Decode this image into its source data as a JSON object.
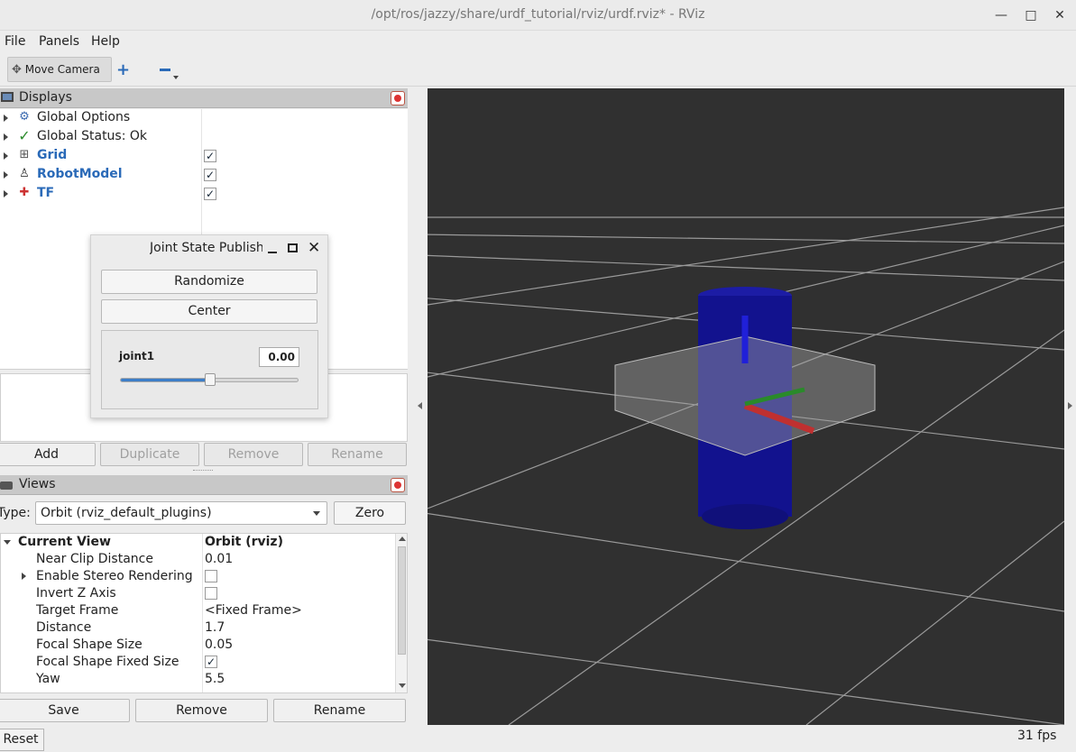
{
  "window": {
    "title": "/opt/ros/jazzy/share/urdf_tutorial/rviz/urdf.rviz* - RViz",
    "minimize_icon": "minimize-icon",
    "maximize_icon": "maximize-icon",
    "close_icon": "close-icon"
  },
  "menu": {
    "file": "File",
    "panels": "Panels",
    "help": "Help"
  },
  "toolbar": {
    "move_camera": "Move Camera"
  },
  "displays": {
    "header": "Displays",
    "items": [
      {
        "label": "Global Options",
        "icon": "gear-icon",
        "checked": null
      },
      {
        "label": "Global Status: Ok",
        "icon": "checkmark-icon",
        "checked": null
      },
      {
        "label": "Grid",
        "icon": "grid-icon",
        "checked": true
      },
      {
        "label": "RobotModel",
        "icon": "robot-icon",
        "checked": true
      },
      {
        "label": "TF",
        "icon": "axes-icon",
        "checked": true
      }
    ],
    "buttons": {
      "add": "Add",
      "duplicate": "Duplicate",
      "remove": "Remove",
      "rename": "Rename"
    }
  },
  "joint_dialog": {
    "title": "Joint State Publishe",
    "randomize": "Randomize",
    "center": "Center",
    "joint_name": "joint1",
    "joint_value": "0.00",
    "slider_fraction": 0.5
  },
  "views": {
    "header": "Views",
    "type_label": "Type:",
    "type_value": "Orbit (rviz_default_plugins)",
    "zero": "Zero",
    "current_view": "Current View",
    "current_view_value": "Orbit (rviz)",
    "props": [
      {
        "key": "Near Clip Distance",
        "value": "0.01"
      },
      {
        "key": "Enable Stereo Rendering",
        "value": "",
        "checkbox": false,
        "expandable": true
      },
      {
        "key": "Invert Z Axis",
        "value": "",
        "checkbox": false
      },
      {
        "key": "Target Frame",
        "value": "<Fixed Frame>"
      },
      {
        "key": "Distance",
        "value": "1.7"
      },
      {
        "key": "Focal Shape Size",
        "value": "0.05"
      },
      {
        "key": "Focal Shape Fixed Size",
        "value": "",
        "checkbox": true
      },
      {
        "key": "Yaw",
        "value": "5.5"
      }
    ],
    "buttons": {
      "save": "Save",
      "remove": "Remove",
      "rename": "Rename"
    }
  },
  "status": {
    "reset": "Reset",
    "fps": "31 fps"
  },
  "colors": {
    "viewport_bg": "#303030",
    "robot_blue": "#1a1aa8",
    "accent_blue": "#2a6ab8"
  }
}
